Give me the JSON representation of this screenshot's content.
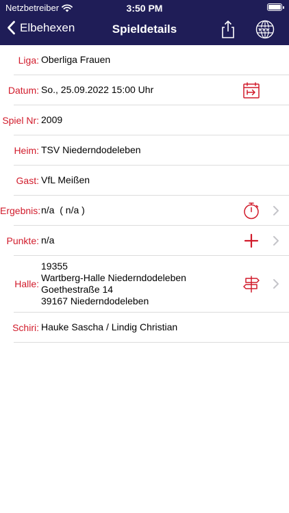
{
  "status_bar": {
    "carrier": "Netzbetreiber",
    "time": "3:50 PM"
  },
  "nav": {
    "back_label": "Elbehexen",
    "title": "Spieldetails"
  },
  "details": {
    "liga": {
      "label": "Liga:",
      "value": "Oberliga Frauen"
    },
    "datum": {
      "label": "Datum:",
      "value": "So., 25.09.2022 15:00 Uhr"
    },
    "spielnr": {
      "label": "Spiel Nr:",
      "value": "2009"
    },
    "heim": {
      "label": "Heim:",
      "value": "TSV Niederndodeleben"
    },
    "gast": {
      "label": "Gast:",
      "value": "VfL Meißen"
    },
    "ergebnis": {
      "label": "Ergebnis:",
      "value": "n/a  ( n/a )"
    },
    "punkte": {
      "label": "Punkte:",
      "value": "n/a"
    },
    "halle": {
      "label": "Halle:",
      "lines": [
        "19355",
        "Wartberg-Halle Niederndodeleben",
        "Goethestraße 14",
        "39167 Niederndodeleben"
      ]
    },
    "schiri": {
      "label": "Schiri:",
      "value": "Hauke Sascha / Lindig Christian"
    }
  },
  "colors": {
    "navbar": "#1f1d57",
    "accent": "#d11a2a",
    "separator": "#dcdcdc"
  },
  "icons": {
    "datum": "calendar-export-icon",
    "ergebnis": "stopwatch-icon",
    "punkte": "plus-icon",
    "halle": "signpost-icon",
    "share": "share-icon",
    "web": "globe-www-icon"
  }
}
